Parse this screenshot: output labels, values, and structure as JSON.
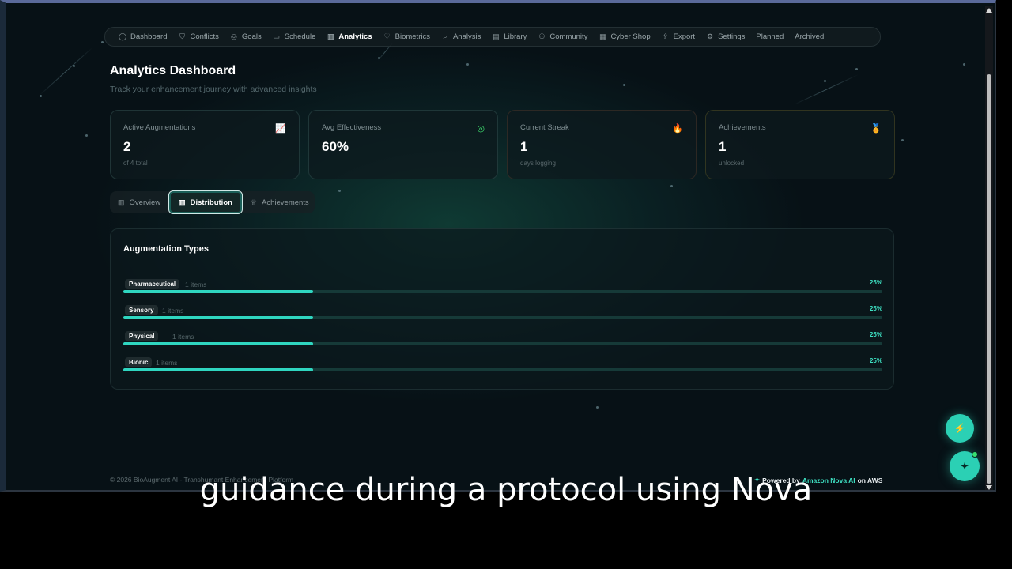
{
  "nav": {
    "items": [
      {
        "icon": "chat-icon",
        "glyph": "◯",
        "label": "Dashboard"
      },
      {
        "icon": "shield-icon",
        "glyph": "⛉",
        "label": "Conflicts"
      },
      {
        "icon": "target-icon",
        "glyph": "◎",
        "label": "Goals"
      },
      {
        "icon": "calendar-icon",
        "glyph": "▭",
        "label": "Schedule"
      },
      {
        "icon": "bar-chart-icon",
        "glyph": "▥",
        "label": "Analytics",
        "active": true
      },
      {
        "icon": "heart-icon",
        "glyph": "♡",
        "label": "Biometrics"
      },
      {
        "icon": "search-icon",
        "glyph": "⌕",
        "label": "Analysis"
      },
      {
        "icon": "book-icon",
        "glyph": "▤",
        "label": "Library"
      },
      {
        "icon": "users-icon",
        "glyph": "⚇",
        "label": "Community"
      },
      {
        "icon": "store-icon",
        "glyph": "▦",
        "label": "Cyber Shop"
      },
      {
        "icon": "export-icon",
        "glyph": "⇪",
        "label": "Export"
      },
      {
        "icon": "gear-icon",
        "glyph": "⚙",
        "label": "Settings"
      },
      {
        "icon": "",
        "glyph": "",
        "label": "Planned"
      },
      {
        "icon": "",
        "glyph": "",
        "label": "Archived"
      }
    ]
  },
  "header": {
    "title": "Analytics Dashboard",
    "subtitle": "Track your enhancement journey with advanced insights"
  },
  "stats": [
    {
      "label": "Active Augmentations",
      "value": "2",
      "sub": "of 4 total",
      "icon": "trend-up-icon",
      "glyph": "📈",
      "color": "#3ee0c2"
    },
    {
      "label": "Avg Effectiveness",
      "value": "60%",
      "sub": "",
      "icon": "target-icon",
      "glyph": "◎",
      "color": "#3ee070"
    },
    {
      "label": "Current Streak",
      "value": "1",
      "sub": "days logging",
      "icon": "flame-icon",
      "glyph": "🔥",
      "color": "#f0663a"
    },
    {
      "label": "Achievements",
      "value": "1",
      "sub": "unlocked",
      "icon": "award-icon",
      "glyph": "🏅",
      "color": "#e8c030"
    }
  ],
  "tabs": [
    {
      "label": "Overview",
      "glyph": "▥",
      "icon": "bar-chart-icon"
    },
    {
      "label": "Distribution",
      "glyph": "▥",
      "icon": "bar-chart-icon",
      "active": true
    },
    {
      "label": "Achievements",
      "glyph": "♕",
      "icon": "trophy-icon"
    }
  ],
  "distribution": {
    "title": "Augmentation Types",
    "rows": [
      {
        "type": "Pharmaceutical",
        "count": "1 items",
        "percent": "25%",
        "value": 0.25
      },
      {
        "type": "Sensory",
        "count": "1 items",
        "percent": "25%",
        "value": 0.25
      },
      {
        "type": "Physical",
        "count": "1 items",
        "percent": "25%",
        "value": 0.25
      },
      {
        "type": "Bionic",
        "count": "1 items",
        "percent": "25%",
        "value": 0.25
      }
    ]
  },
  "footer": {
    "copyright": "© 2026 BioAugment AI - Transhumant Enhancement Platform",
    "powered_prefix": "Powered by",
    "powered_brand": "Amazon Nova AI",
    "powered_suffix": "on AWS"
  },
  "fabs": {
    "quick": {
      "icon": "lightning-icon",
      "glyph": "⚡"
    },
    "assistant": {
      "icon": "sparkle-icon",
      "glyph": "✦"
    }
  },
  "caption": "guidance during a protocol using Nova",
  "colors": {
    "accent": "#2fd6c0",
    "background": "#071116"
  }
}
